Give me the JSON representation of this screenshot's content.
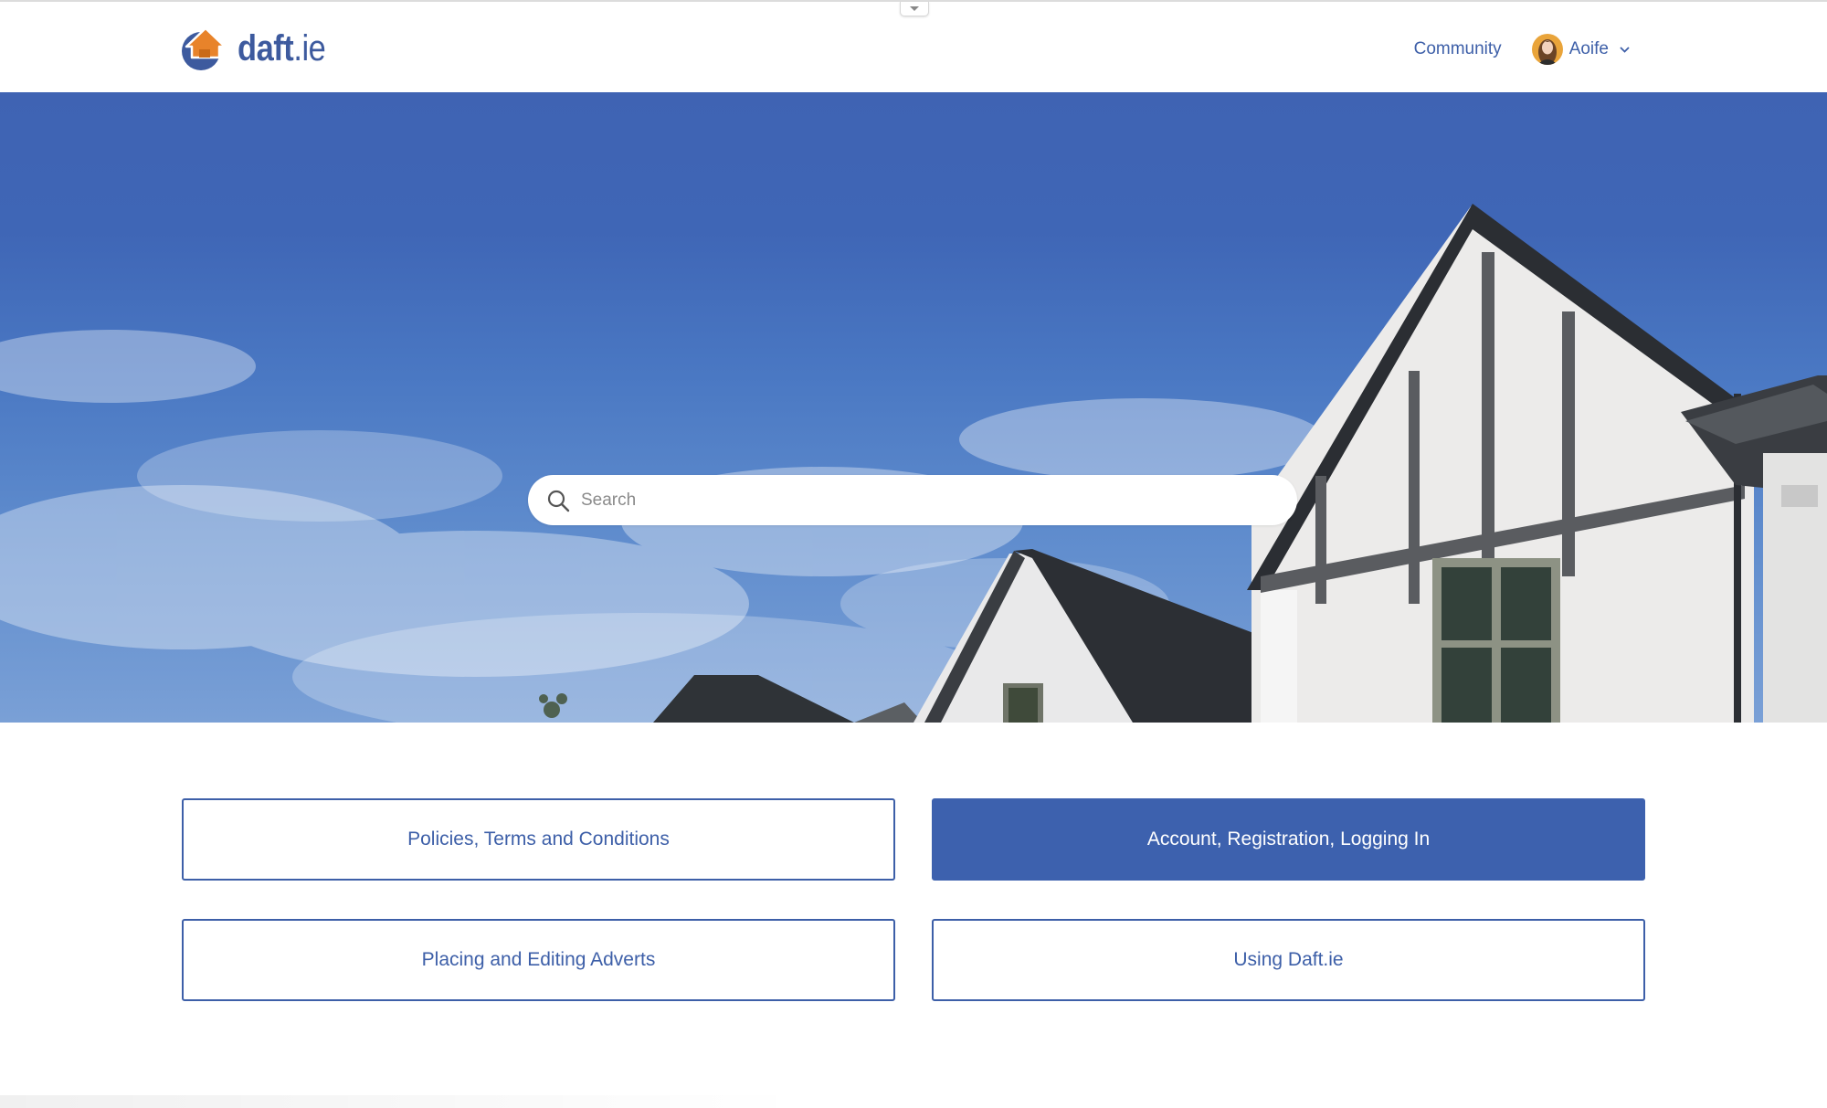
{
  "header": {
    "logo": {
      "brand": "daft",
      "tld": ".ie",
      "icon": "house-logo-icon"
    },
    "nav": {
      "community_label": "Community",
      "user": {
        "name": "Aoife",
        "avatar_icon": "user-avatar",
        "dropdown_icon": "chevron-down-icon"
      }
    },
    "collapse_icon": "chevron-down-icon"
  },
  "hero": {
    "search": {
      "placeholder": "Search",
      "value": "",
      "icon": "search-icon"
    }
  },
  "categories": [
    {
      "label": "Policies, Terms and Conditions",
      "active": false
    },
    {
      "label": "Account, Registration, Logging In",
      "active": true
    },
    {
      "label": "Placing and Editing Adverts",
      "active": false
    },
    {
      "label": "Using Daft.ie",
      "active": false
    }
  ],
  "colors": {
    "brand_blue": "#3d5fa8",
    "active_button": "#3d61ae",
    "logo_orange": "#e8832a",
    "sky_top": "#3f63b3"
  }
}
